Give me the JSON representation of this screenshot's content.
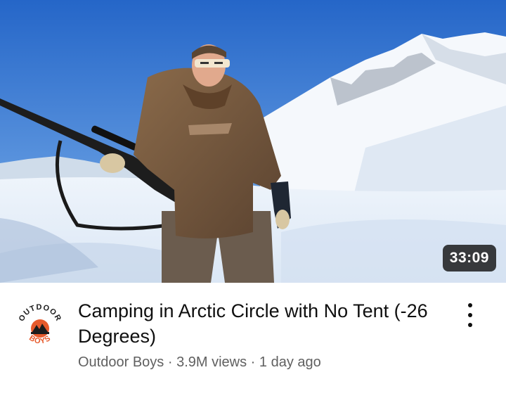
{
  "video": {
    "duration": "33:09",
    "title": "Camping in Arctic Circle with No Tent (-26 Degrees)",
    "channel": "Outdoor Boys",
    "views": "3.9M views",
    "age": "1 day ago",
    "separator": " · "
  },
  "avatar": {
    "logo_text_top": "OUTDOOR",
    "logo_text_bottom": "BOYS"
  },
  "icons": {
    "menu": "more-vertical-icon"
  },
  "colors": {
    "sky": "#2f74d0",
    "snow": "#e9f1fa",
    "text_primary": "#0f0f0f",
    "text_secondary": "#606060",
    "logo_accent": "#e65a2c"
  }
}
